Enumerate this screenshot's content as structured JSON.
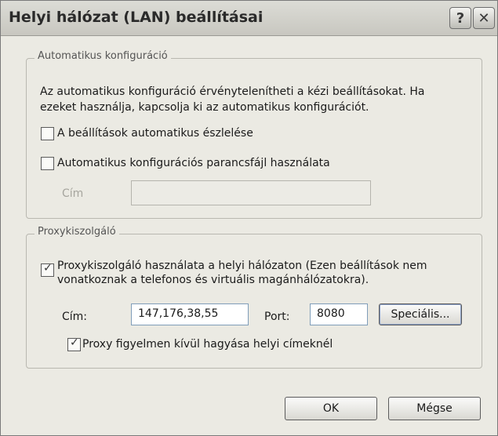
{
  "dialog": {
    "title": "Helyi hálózat (LAN) beállításai",
    "help_label": "?",
    "close_label": "✕"
  },
  "auto_config": {
    "group_title": "Automatikus konfiguráció",
    "description_line1": "Az automatikus konfiguráció érvénytelenítheti a kézi beállításokat.  Ha",
    "description_line2": "ezeket használja, kapcsolja ki az automatikus konfigurációt.",
    "detect_label": "A beállítások automatikus észlelése",
    "detect_checked": false,
    "script_label": "Automatikus konfigurációs parancsfájl használata",
    "script_checked": false,
    "address_label": "Cím",
    "address_value": ""
  },
  "proxy": {
    "group_title": "Proxykiszolgáló",
    "use_label_line1": "Proxykiszolgáló használata a helyi hálózaton (Ezen beállítások nem",
    "use_label_line2": "vonatkoznak a telefonos és virtuális magánhálózatokra).",
    "use_checked": true,
    "address_label": "Cím:",
    "address_value": "147,176,38,55",
    "port_label": "Port:",
    "port_value": "8080",
    "advanced_label": "Speciális...",
    "bypass_label": "Proxy figyelmen kívül hagyása helyi címeknél",
    "bypass_checked": true
  },
  "buttons": {
    "ok_label": "OK",
    "cancel_label": "Mégse"
  }
}
